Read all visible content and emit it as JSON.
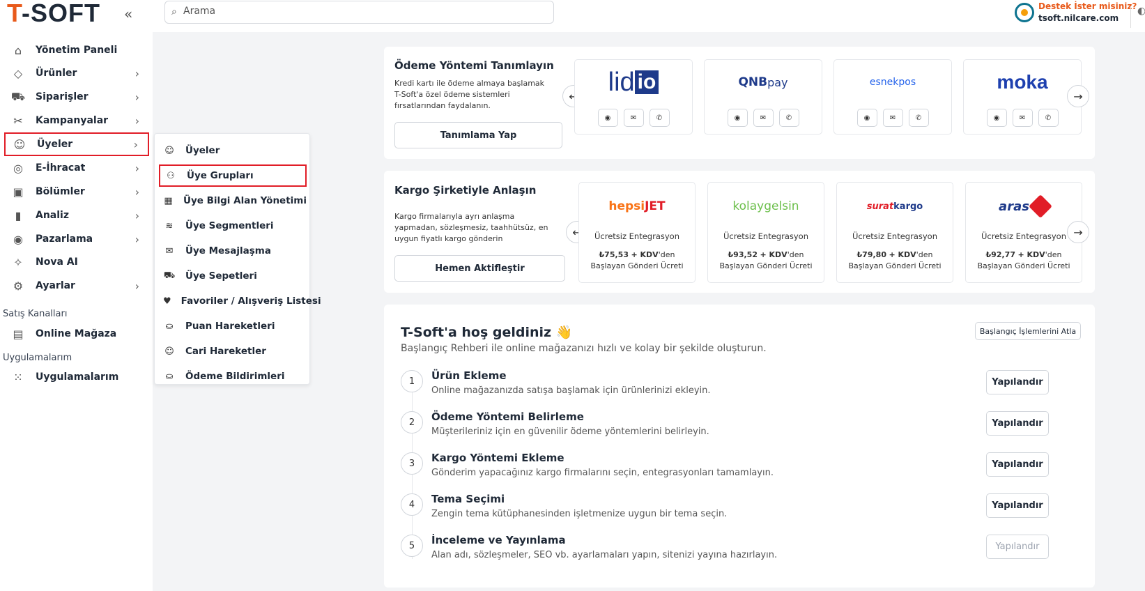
{
  "header": {
    "logo_accent": "T",
    "logo_rest": "-SOFT",
    "collapse_glyph": "«",
    "search_placeholder": "Arama",
    "support_title": "Destek İster misiniz?",
    "support_domain": "tsoft.nilcare.com"
  },
  "sidebar": {
    "items": [
      {
        "label": "Yönetim Paneli",
        "icon": "home-icon",
        "glyph": "⌂",
        "chevron": false
      },
      {
        "label": "Ürünler",
        "icon": "tag-icon",
        "glyph": "◇",
        "chevron": true
      },
      {
        "label": "Siparişler",
        "icon": "cart-icon",
        "glyph": "⛟",
        "chevron": true
      },
      {
        "label": "Kampanyalar",
        "icon": "campaign-icon",
        "glyph": "✂",
        "chevron": true
      },
      {
        "label": "Üyeler",
        "icon": "members-icon",
        "glyph": "☺",
        "chevron": true
      },
      {
        "label": "E-İhracat",
        "icon": "globe-icon",
        "glyph": "◎",
        "chevron": true
      },
      {
        "label": "Bölümler",
        "icon": "sections-icon",
        "glyph": "▣",
        "chevron": true
      },
      {
        "label": "Analiz",
        "icon": "analytics-icon",
        "glyph": "▮",
        "chevron": true
      },
      {
        "label": "Pazarlama",
        "icon": "marketing-icon",
        "glyph": "◉",
        "chevron": true
      },
      {
        "label": "Nova AI",
        "icon": "ai-sparkle-icon",
        "glyph": "✧",
        "chevron": false
      },
      {
        "label": "Ayarlar",
        "icon": "gear-icon",
        "glyph": "⚙",
        "chevron": true
      }
    ],
    "sales_channels_label": "Satış Kanalları",
    "online_store": {
      "label": "Online Mağaza",
      "glyph": "▤"
    },
    "apps_label": "Uygulamalarım",
    "apps": {
      "label": "Uygulamalarım",
      "glyph": "⁙"
    }
  },
  "submenu": {
    "items": [
      {
        "label": "Üyeler",
        "icon": "members-icon",
        "glyph": "☺"
      },
      {
        "label": "Üye Grupları",
        "icon": "member-groups-icon",
        "glyph": "⚇"
      },
      {
        "label": "Üye Bilgi Alan Yönetimi",
        "icon": "form-icon",
        "glyph": "▦"
      },
      {
        "label": "Üye Segmentleri",
        "icon": "layers-icon",
        "glyph": "≋"
      },
      {
        "label": "Üye Mesajlaşma",
        "icon": "mail-icon",
        "glyph": "✉"
      },
      {
        "label": "Üye Sepetleri",
        "icon": "cart-icon",
        "glyph": "⛟"
      },
      {
        "label": "Favoriler / Alışveriş Listesi",
        "icon": "heart-icon",
        "glyph": "♥"
      },
      {
        "label": "Puan Hareketleri",
        "icon": "hand-coin-icon",
        "glyph": "⛀"
      },
      {
        "label": "Cari Hareketler",
        "icon": "members-icon",
        "glyph": "☺"
      },
      {
        "label": "Ödeme Bildirimleri",
        "icon": "hand-coin-icon",
        "glyph": "⛀"
      }
    ]
  },
  "payment": {
    "title": "Ödeme Yöntemi Tanımlayın",
    "description": "Kredi kartı ile ödeme almaya başlamak T-Soft'a özel ödeme sistemleri fırsatlarından faydalanın.",
    "button": "Tanımlama Yap",
    "providers": [
      {
        "name": "lidio",
        "part1": "lid",
        "part2": "io"
      },
      {
        "name": "QNBpay",
        "part1": "QNB",
        "part2": "pay"
      },
      {
        "name": "esnekpos",
        "part1": "esnekpos",
        "part2": ""
      },
      {
        "name": "moka",
        "part1": "moka",
        "part2": ""
      }
    ],
    "contact_icons": {
      "web": "◉",
      "mail": "✉",
      "phone": "✆"
    },
    "prev_glyph": "←",
    "next_glyph": "→"
  },
  "cargo": {
    "title": "Kargo Şirketiyle Anlaşın",
    "description": "Kargo firmalarıyla ayrı anlaşma yapmadan, sözleşmesiz, taahhütsüz, en uygun fiyatlı kargo gönderin",
    "button": "Hemen Aktifleştir",
    "companies": [
      {
        "part1": "hepsi",
        "part2": "JET",
        "integration": "Ücretsiz Entegrasyon",
        "price": "₺75,53",
        "kdv": "+ KDV",
        "suffix": "'den Başlayan Gönderi Ücreti"
      },
      {
        "part1": "kolay",
        "part2": "gelsin",
        "integration": "Ücretsiz Entegrasyon",
        "price": "₺93,52",
        "kdv": "+ KDV",
        "suffix": "'den Başlayan Gönderi Ücreti"
      },
      {
        "part1": "surat",
        "part2": "kargo",
        "integration": "Ücretsiz Entegrasyon",
        "price": "₺79,80",
        "kdv": "+ KDV",
        "suffix": "'den Başlayan Gönderi Ücreti"
      },
      {
        "part1": "aras",
        "part2": "",
        "integration": "Ücretsiz Entegrasyon",
        "price": "₺92,77",
        "kdv": "+ KDV",
        "suffix": "'den Başlayan Gönderi Ücreti"
      }
    ],
    "prev_glyph": "←",
    "next_glyph": "→"
  },
  "welcome": {
    "title": "T-Soft'a hoş geldiniz 👋",
    "subtitle": "Başlangıç Rehberi ile online mağazanızı hızlı ve kolay bir şekilde oluşturun.",
    "skip_button": "Başlangıç İşlemlerini Atla",
    "steps": [
      {
        "num": "1",
        "title": "Ürün Ekleme",
        "desc": "Online mağazanızda satışa başlamak için ürünlerinizi ekleyin.",
        "button": "Yapılandır",
        "disabled": false
      },
      {
        "num": "2",
        "title": "Ödeme Yöntemi Belirleme",
        "desc": "Müşterileriniz için en güvenilir ödeme yöntemlerini belirleyin.",
        "button": "Yapılandır",
        "disabled": false
      },
      {
        "num": "3",
        "title": "Kargo Yöntemi Ekleme",
        "desc": "Gönderim yapacağınız kargo firmalarını seçin, entegrasyonları tamamlayın.",
        "button": "Yapılandır",
        "disabled": false
      },
      {
        "num": "4",
        "title": "Tema Seçimi",
        "desc": "Zengin tema kütüphanesinden işletmenize uygun bir tema seçin.",
        "button": "Yapılandır",
        "disabled": false
      },
      {
        "num": "5",
        "title": "İnceleme ve Yayınlama",
        "desc": "Alan adı, sözleşmeler, SEO vb. ayarlamaları yapın, sitenizi yayına hazırlayın.",
        "button": "Yapılandır",
        "disabled": true
      }
    ]
  },
  "colors": {
    "brand": "#e85a1b",
    "highlight": "#e11d27"
  }
}
